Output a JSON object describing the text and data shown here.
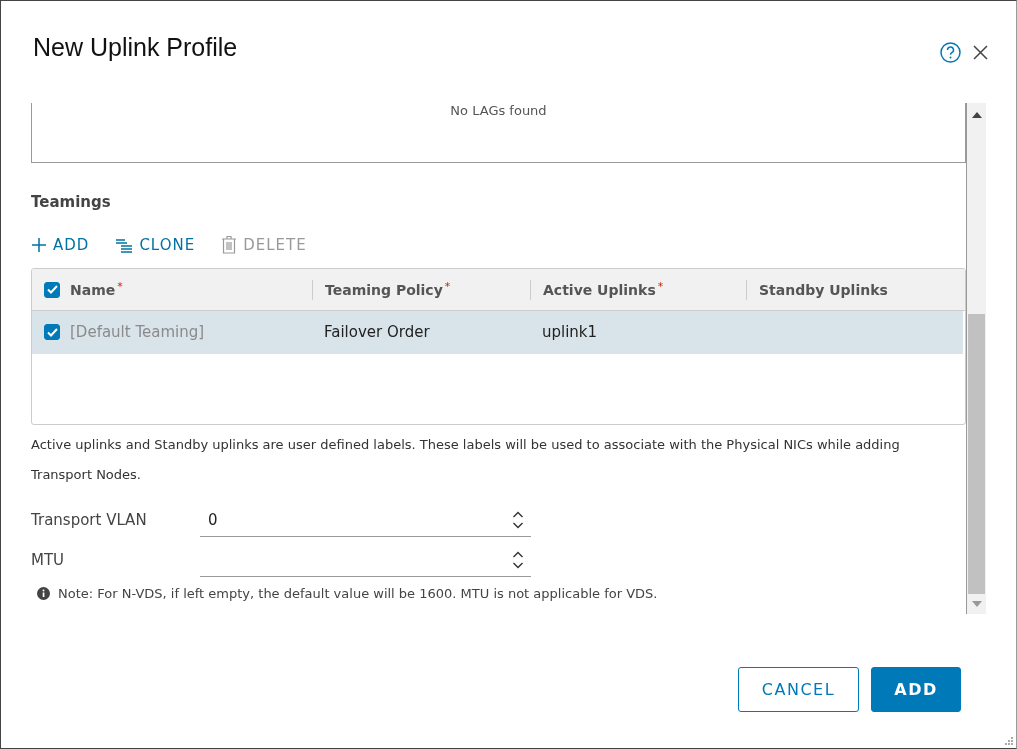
{
  "dialog": {
    "title": "New Uplink Profile"
  },
  "lags": {
    "empty_text": "No LAGs found"
  },
  "teamings": {
    "heading": "Teamings",
    "actions": [
      {
        "label": "ADD",
        "kind": "add",
        "disabled": false
      },
      {
        "label": "CLONE",
        "kind": "clone",
        "disabled": false
      },
      {
        "label": "DELETE",
        "kind": "delete",
        "disabled": true
      }
    ],
    "header_checked": true,
    "columns": [
      {
        "label": "Name",
        "marker": "*"
      },
      {
        "label": "Teaming Policy",
        "marker": "*"
      },
      {
        "label": "Active Uplinks",
        "marker": "*"
      },
      {
        "label": "Standby Uplinks"
      }
    ],
    "rows": [
      {
        "selected": true,
        "name": "[Default Teaming]",
        "policy": "Failover Order",
        "active": "uplink1"
      }
    ],
    "help": "Active uplinks and Standby uplinks are user defined labels. These labels will be used to associate with the Physical NICs while adding Transport Nodes."
  },
  "fields": [
    {
      "label": "Transport VLAN",
      "value": "0"
    },
    {
      "label": "MTU"
    }
  ],
  "note": "Note: For N-VDS, if left empty, the default value will be 1600. MTU is not applicable for VDS.",
  "buttons": [
    {
      "label": "CANCEL",
      "kind": "secondary"
    },
    {
      "label": "ADD",
      "kind": "primary"
    }
  ]
}
